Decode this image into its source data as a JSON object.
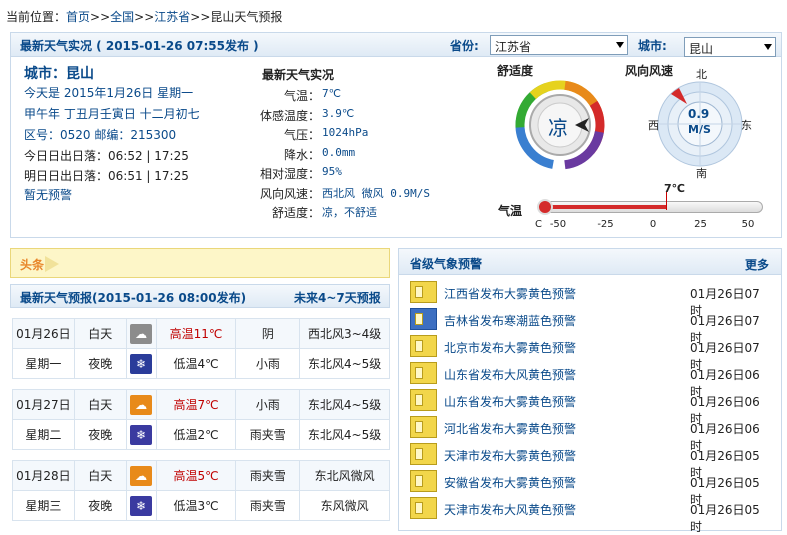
{
  "breadcrumb": {
    "label": "当前位置：",
    "items": [
      "首页",
      "全国",
      "江苏省",
      "昆山天气预报"
    ],
    "sep": ">>"
  },
  "top": {
    "title": "最新天气实况 ( 2015-01-26  07:55发布 )",
    "province_label": "省份:",
    "province_value": "江苏省",
    "city_label": "城市:",
    "city_value": "昆山"
  },
  "info": {
    "city": "城市：昆山",
    "today": "今天是 2015年1月26日 星期一",
    "lunar": "甲午年 丁丑月壬寅日 十二月初七",
    "codes": "区号：0520  邮编：215300",
    "today_sun": "今日日出日落：06:52  |  17:25",
    "tomorrow_sun": "明日日出日落：06:51  |  17:25",
    "alert": "暂无预警"
  },
  "live": {
    "title": "最新天气实况",
    "rows": [
      {
        "label": "气温：",
        "value": "7℃"
      },
      {
        "label": "体感温度：",
        "value": "3.9℃"
      },
      {
        "label": "气压：",
        "value": "1024hPa"
      },
      {
        "label": "降水：",
        "value": "0.0mm"
      },
      {
        "label": "相对湿度：",
        "value": "95%"
      },
      {
        "label": "风向风速：",
        "value": "西北风 微风 0.9M/S"
      },
      {
        "label": "舒适度：",
        "value": "凉，不舒适"
      }
    ]
  },
  "comfort": {
    "title": "舒适度",
    "value": "凉"
  },
  "wind": {
    "title": "风向风速",
    "speed": "0.9",
    "unit": "M/S",
    "n": "北",
    "s": "南",
    "e": "东",
    "w": "西"
  },
  "temp": {
    "title": "气温",
    "value": "7℃",
    "ticks": [
      "-50",
      "-25",
      "0",
      "25",
      "50"
    ],
    "unit": "C",
    "current": 7,
    "min": -50,
    "max": 50
  },
  "headline": {
    "label": "头条"
  },
  "forecast": {
    "title": "最新天气预报(2015-01-26  08:00发布)",
    "more": "未来4~7天预报",
    "days": [
      {
        "date": "01月26日",
        "week": "星期一",
        "day": {
          "period": "白天",
          "icon": "cloudy-icon",
          "temp": "高温11℃",
          "weather": "阴",
          "wind": "西北风3~4级"
        },
        "night": {
          "period": "夜晚",
          "icon": "light-rain-icon",
          "temp": "低温4℃",
          "weather": "小雨",
          "wind": "东北风4~5级"
        }
      },
      {
        "date": "01月27日",
        "week": "星期二",
        "day": {
          "period": "白天",
          "icon": "light-rain-icon",
          "temp": "高温7℃",
          "weather": "小雨",
          "wind": "东北风4~5级"
        },
        "night": {
          "period": "夜晚",
          "icon": "sleet-icon",
          "temp": "低温2℃",
          "weather": "雨夹雪",
          "wind": "东北风4~5级"
        }
      },
      {
        "date": "01月28日",
        "week": "星期三",
        "day": {
          "period": "白天",
          "icon": "sleet-icon",
          "temp": "高温5℃",
          "weather": "雨夹雪",
          "wind": "东北风微风"
        },
        "night": {
          "period": "夜晚",
          "icon": "sleet-icon",
          "temp": "低温3℃",
          "weather": "雨夹雪",
          "wind": "东风微风"
        }
      }
    ]
  },
  "warnings": {
    "title": "省级气象预警",
    "more": "更多",
    "items": [
      {
        "text": "江西省发布大雾黄色预警",
        "time": "01月26日07时",
        "color": "yellow"
      },
      {
        "text": "吉林省发布寒潮蓝色预警",
        "time": "01月26日07时",
        "color": "blue"
      },
      {
        "text": "北京市发布大雾黄色预警",
        "time": "01月26日07时",
        "color": "yellow"
      },
      {
        "text": "山东省发布大风黄色预警",
        "time": "01月26日06时",
        "color": "yellow"
      },
      {
        "text": "山东省发布大雾黄色预警",
        "time": "01月26日06时",
        "color": "yellow"
      },
      {
        "text": "河北省发布大雾黄色预警",
        "time": "01月26日06时",
        "color": "yellow"
      },
      {
        "text": "天津市发布大雾黄色预警",
        "time": "01月26日05时",
        "color": "yellow"
      },
      {
        "text": "安徽省发布大雾黄色预警",
        "time": "01月26日05时",
        "color": "yellow"
      },
      {
        "text": "天津市发布大风黄色预警",
        "time": "01月26日05时",
        "color": "yellow"
      }
    ]
  },
  "colors": {
    "link": "#0a4a8a",
    "high": "#c00000",
    "headline": "#e8862a"
  }
}
